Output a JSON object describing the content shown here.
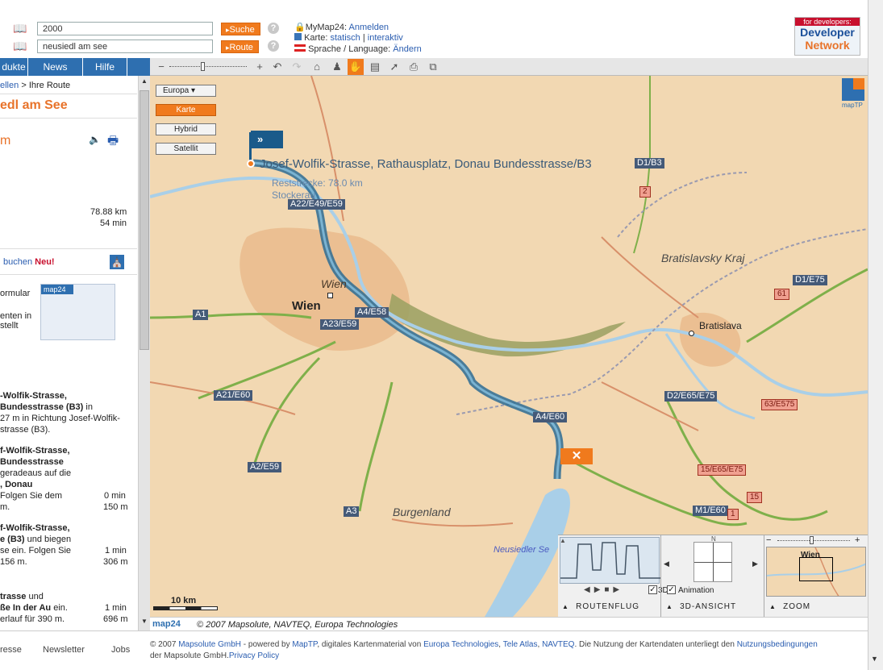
{
  "search": {
    "field1_value": "2000",
    "field2_value": "neusiedl am see",
    "search_btn": "Suche",
    "route_btn": "Route"
  },
  "account": {
    "mymap_label": "MyMap24:",
    "login_link": "Anmelden",
    "karte_label": "Karte:",
    "statisch": "statisch",
    "sep": "|",
    "interaktiv": "interaktiv",
    "lang_label": "Sprache / Language:",
    "change_link": "Ändern"
  },
  "devnet": {
    "badge": "for developers:",
    "line1": "Developer",
    "line2": "Network"
  },
  "nav": [
    "dukte",
    "News",
    "Hilfe"
  ],
  "left": {
    "breadcrumb_prev": "ellen",
    "breadcrumb_sep": ">",
    "breadcrumb_cur": "Ihre Route",
    "title": "edl am See",
    "subtitle": "m",
    "distance": "78.88 km",
    "duration": "54 min",
    "hotel_text": "buchen",
    "hotel_new": "Neu!",
    "form_line1": "ormular",
    "form_line2": "enten in",
    "form_line3": "stellt",
    "map24_brand": "map24",
    "step1_line1": "-Wolfik-Strasse,",
    "step1_line2": "Bundesstrasse (B3)",
    "step1_line2b": "in",
    "step1_line3": "27 m in Richtung Josef-Wolfik-",
    "step1_line4": "strasse (B3).",
    "step2_line1": "f-Wolfik-Strasse,",
    "step2_line2": "Bundesstrasse",
    "step2_line3": "geradeaus auf die",
    "step2_line4": ", Donau",
    "step2_line5": "Folgen Sie dem",
    "step2_time": "0 min",
    "step2_line6": "m.",
    "step2_dist": "150 m",
    "step3_line1": "f-Wolfik-Strasse,",
    "step3_line2": "e (B3)",
    "step3_line2b": "und biegen",
    "step3_line3": "se ein. Folgen Sie",
    "step3_time": "1 min",
    "step3_line4": "156 m.",
    "step3_dist": "306 m",
    "step4_line1": "trasse",
    "step4_line1b": "und",
    "step4_line2": "ße In der Au",
    "step4_line2b": "ein.",
    "step4_time": "1 min",
    "step4_line3": "erlauf für 390 m.",
    "step4_dist": "696 m"
  },
  "map": {
    "region_select": "Europa",
    "btn_karte": "Karte",
    "btn_hybrid": "Hybrid",
    "btn_satellit": "Satellit",
    "start_label": "Josef-Wolfik-Strasse, Rathausplatz, Donau Bundesstrasse/B3",
    "rest_label": "Reststrecke: 78.0 km",
    "stockerau": "Stockerau",
    "wien_italic": "Wien",
    "wien": "Wien",
    "bratislavsky": "Bratislavsky Kraj",
    "bratislava": "Bratislava",
    "burgenland": "Burgenland",
    "neusiedler": "Neusiedler Se",
    "roads_blue": [
      "A22/E49/E59",
      "A1",
      "A4/E58",
      "A23/E59",
      "A21/E60",
      "A2/E59",
      "A3",
      "A4/E60",
      "D2/E65/E75",
      "D1/E75",
      "M1/E60",
      "D1/B3"
    ],
    "roads_red": [
      "2",
      "61",
      "63/E575",
      "15/E65/E75",
      "15",
      "1"
    ],
    "scale": "10 km",
    "copyright": "© 2007 Mapsolute, NAVTEQ, Europa Technologies",
    "map24_logo": "map24",
    "maptp": "mapTP",
    "compass_n": "N",
    "chk_3d": "3D",
    "chk_animation": "Animation",
    "panel_route": "ROUTENFLUG",
    "panel_3d": "3D-ANSICHT",
    "panel_zoom": "ZOOM",
    "mini_wien": "Wien"
  },
  "footer": {
    "left_links": [
      "resse",
      "Newsletter",
      "Jobs"
    ],
    "copy_prefix": "© 2007",
    "mapsolute": "Mapsolute GmbH",
    "powered": "- powered by",
    "maptp": "MapTP",
    "kartenmaterial": ", digitales Kartenmaterial von",
    "europa": "Europa Technologies",
    "comma1": ",",
    "teleatlas": "Tele Atlas",
    "comma2": ",",
    "navteq": "NAVTEQ",
    "nutzung_text": ". Die Nutzung der Kartendaten unterliegt den",
    "nutzung_link": "Nutzungsbedingungen",
    "line2_prefix": "der Mapsolute GmbH.",
    "privacy": "Privacy Policy"
  },
  "colors": {
    "accent": "#f07a1d",
    "nav": "#2e6fb0",
    "route": "#3f7fa8",
    "map_bg": "#f2d8b2"
  }
}
